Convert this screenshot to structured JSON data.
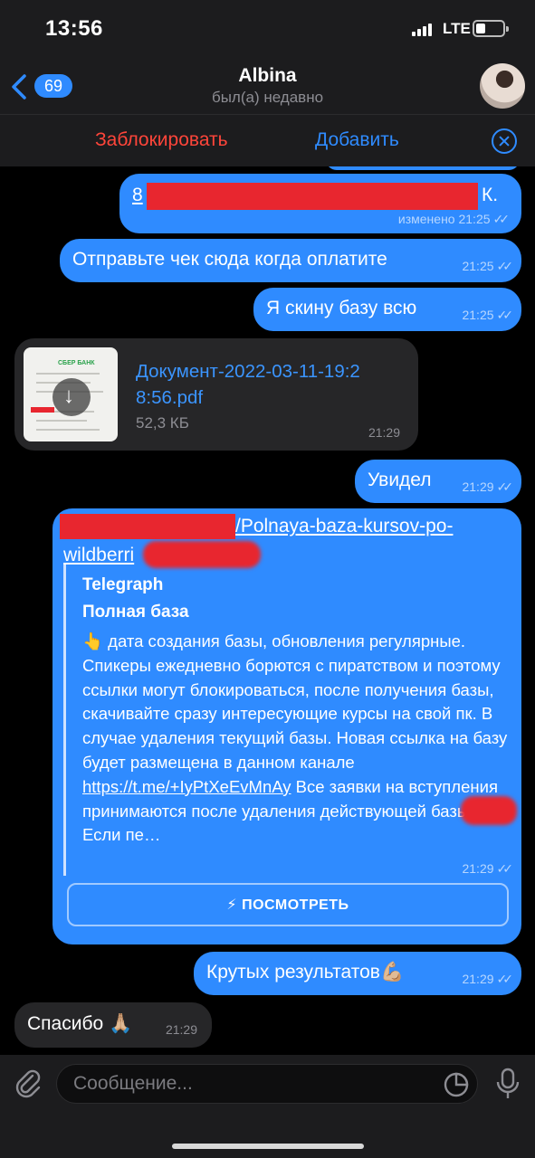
{
  "status_bar": {
    "time": "13:56",
    "network": "LTE"
  },
  "header": {
    "back_count": "69",
    "title": "Albina",
    "subtitle": "был(а) недавно"
  },
  "action_bar": {
    "block_label": "Заблокировать",
    "add_label": "Добавить"
  },
  "messages": [
    {
      "dir": "out",
      "text_start": "8",
      "text_end": "К.",
      "edited_label": "изменено",
      "time": "21:25"
    },
    {
      "dir": "out",
      "text": "Отправьте чек сюда когда оплатите",
      "time": "21:25"
    },
    {
      "dir": "out",
      "text": "Я скину базу всю",
      "time": "21:25"
    },
    {
      "dir": "in",
      "file_name_line1": "Документ-2022-03-11-19:2",
      "file_name_line2": "8:56.pdf",
      "file_size": "52,3 КБ",
      "thumb_bank": "СБЕР БАНК",
      "time": "21:29"
    },
    {
      "dir": "out",
      "text": "Увидел",
      "time": "21:29"
    },
    {
      "dir": "out",
      "link_line1": "/Polnaya-baza-kursov-po-",
      "link_line2": "wildberri",
      "preview_site": "Telegraph",
      "preview_title": "Полная база",
      "preview_emoji": "👆",
      "preview_text": " дата создания базы, обновления регулярные. Спикеры ежедневно борются с пиратством и поэтому ссылки могут блокироваться, после получения базы, скачивайте сразу интересующие курсы на свой пк. В случае удаления текущий базы. Новая ссылка на базу будет размещена в данном канале ",
      "preview_link": "https://t.me/+IyPtXeEvMnAy",
      "preview_text_end": " Все заявки на вступления принимаются после удаления действующей базы Если пе…",
      "button_label": "⚡ ПОСМОТРЕТЬ",
      "time": "21:29"
    },
    {
      "dir": "out",
      "text": "Крутых результатов",
      "emoji": "💪🏼",
      "time": "21:29"
    },
    {
      "dir": "in",
      "text": "Спасибо",
      "emoji": "🙏🏼",
      "time": "21:29"
    }
  ],
  "input": {
    "placeholder": "Сообщение..."
  },
  "icons": {
    "back": "chevron-left-icon",
    "close": "close-circle-icon",
    "attach": "paperclip-icon",
    "sticker": "sticker-icon",
    "mic": "microphone-icon",
    "read": "double-check-icon"
  },
  "colors": {
    "accent": "#2f8bff",
    "danger": "#ff453a",
    "outgoing": "#2f8bff",
    "incoming": "#262628"
  }
}
